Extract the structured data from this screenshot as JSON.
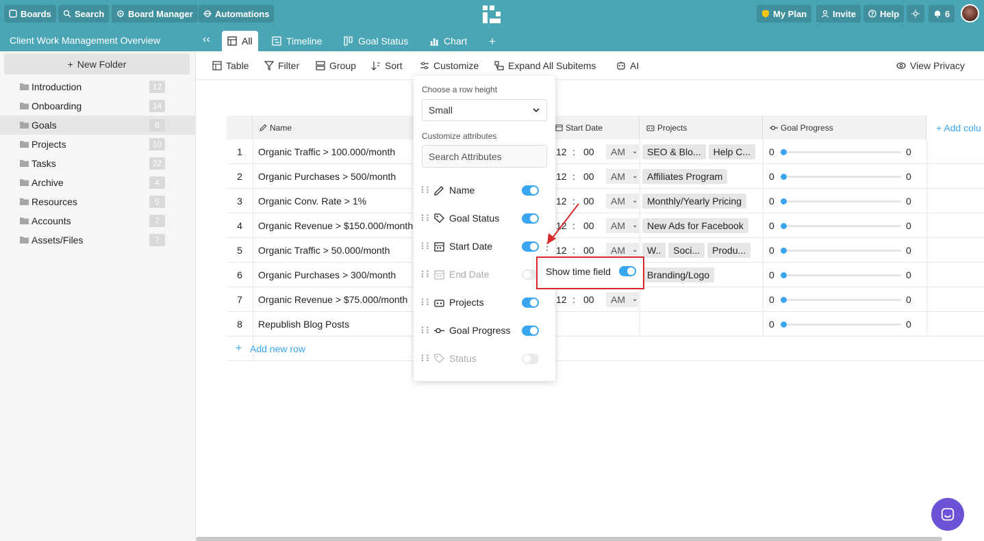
{
  "topbar": {
    "boards": "Boards",
    "search": "Search",
    "board_manager": "Board Manager",
    "automations": "Automations",
    "my_plan": "My Plan",
    "invite": "Invite",
    "help": "Help",
    "notifications_count": "6"
  },
  "workspace_title": "Client Work Management Overview",
  "tabs": [
    {
      "label": "All",
      "icon": "table-icon"
    },
    {
      "label": "Timeline",
      "icon": "timeline-icon"
    },
    {
      "label": "Goal Status",
      "icon": "kanban-icon"
    },
    {
      "label": "Chart",
      "icon": "chart-icon"
    }
  ],
  "sidebar": {
    "new_folder": "New Folder",
    "folders": [
      {
        "name": "Introduction",
        "count": "12"
      },
      {
        "name": "Onboarding",
        "count": "14"
      },
      {
        "name": "Goals",
        "count": "8"
      },
      {
        "name": "Projects",
        "count": "10"
      },
      {
        "name": "Tasks",
        "count": "22"
      },
      {
        "name": "Archive",
        "count": "4"
      },
      {
        "name": "Resources",
        "count": "5"
      },
      {
        "name": "Accounts",
        "count": "7"
      },
      {
        "name": "Assets/Files",
        "count": "7"
      }
    ]
  },
  "toolbar": {
    "table": "Table",
    "filter": "Filter",
    "group": "Group",
    "sort": "Sort",
    "customize": "Customize",
    "expand": "Expand All Subitems",
    "ai": "AI",
    "view_privacy": "View Privacy"
  },
  "table": {
    "headers": {
      "name": "Name",
      "start_date": "Start Date",
      "projects": "Projects",
      "goal_progress": "Goal Progress",
      "add_column": "+ Add colu"
    },
    "time_hour": "12",
    "time_sep": ":",
    "time_min": "00",
    "ampm": "AM",
    "progress_value": "0",
    "progress_max": "0",
    "rows": [
      {
        "num": "1",
        "name": "Organic Traffic > 100.000/month",
        "projects": [
          "SEO & Blo...",
          "Help C..."
        ],
        "has_time": true
      },
      {
        "num": "2",
        "name": "Organic Purchases > 500/month",
        "projects": [
          "Affiliates Program"
        ],
        "has_time": true
      },
      {
        "num": "3",
        "name": "Organic Conv. Rate > 1%",
        "projects": [
          "Monthly/Yearly Pricing"
        ],
        "has_time": true
      },
      {
        "num": "4",
        "name": "Organic Revenue > $150.000/month",
        "projects": [
          "New Ads for Facebook"
        ],
        "has_time": true
      },
      {
        "num": "5",
        "name": "Organic Traffic > 50.000/month",
        "projects": [
          "W..",
          "Soci...",
          "Produ..."
        ],
        "has_time": true
      },
      {
        "num": "6",
        "name": "Organic Purchases > 300/month",
        "projects": [
          "Branding/Logo"
        ],
        "has_time": false
      },
      {
        "num": "7",
        "name": "Organic Revenue > $75.000/month",
        "projects": [],
        "has_time": true
      },
      {
        "num": "8",
        "name": "Republish Blog Posts",
        "projects": [],
        "has_time": false
      }
    ],
    "add_row": "Add new row"
  },
  "customize_popup": {
    "row_height_label": "Choose a row height",
    "row_height_value": "Small",
    "attributes_label": "Customize attributes",
    "search_placeholder": "Search Attributes",
    "attributes": [
      {
        "name": "Name",
        "on": true,
        "icon": "pencil-icon"
      },
      {
        "name": "Goal Status",
        "on": true,
        "icon": "tag-icon"
      },
      {
        "name": "Start Date",
        "on": true,
        "icon": "calendar-icon"
      },
      {
        "name": "End Date",
        "on": false,
        "icon": "calendar-icon"
      },
      {
        "name": "Projects",
        "on": true,
        "icon": "projects-icon"
      },
      {
        "name": "Goal Progress",
        "on": true,
        "icon": "progress-icon"
      },
      {
        "name": "Status",
        "on": false,
        "icon": "tag-icon"
      }
    ]
  },
  "time_popover": {
    "label": "Show time field",
    "on": true
  },
  "colors": {
    "brand": "#4aa5b5",
    "accent": "#3aa6f0",
    "highlight": "#d9282a",
    "chat": "#6b52d6"
  }
}
